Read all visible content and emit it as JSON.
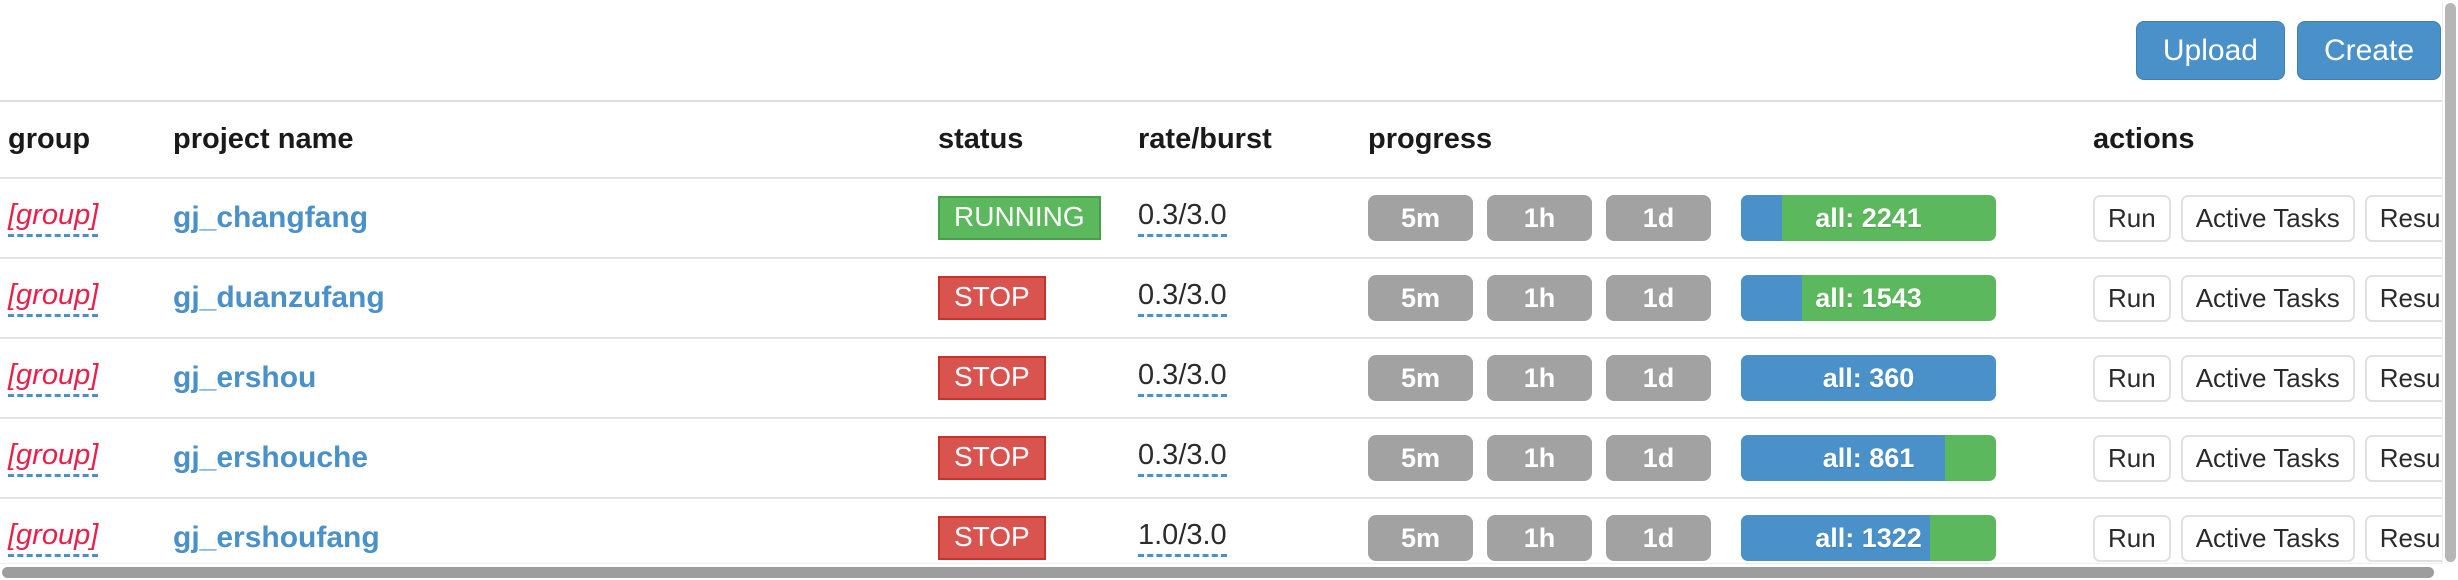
{
  "toolbar": {
    "upload_label": "Upload",
    "create_label": "Create"
  },
  "table": {
    "headers": {
      "group": "group",
      "project_name": "project name",
      "status": "status",
      "rate_burst": "rate/burst",
      "progress": "progress",
      "actions": "actions"
    },
    "time_buttons": {
      "m5": "5m",
      "h1": "1h",
      "d1": "1d"
    },
    "action_buttons": {
      "run": "Run",
      "active_tasks": "Active Tasks",
      "results": "Results"
    },
    "rows": [
      {
        "group": "[group]",
        "name": "gj_changfang",
        "status": "RUNNING",
        "status_kind": "running",
        "rate": "0.3/3.0",
        "progress_label": "all: 2241",
        "progress_all": 2241,
        "blue_pct": 16,
        "green_pct": 84
      },
      {
        "group": "[group]",
        "name": "gj_duanzufang",
        "status": "STOP",
        "status_kind": "stop",
        "rate": "0.3/3.0",
        "progress_label": "all: 1543",
        "progress_all": 1543,
        "blue_pct": 24,
        "green_pct": 76
      },
      {
        "group": "[group]",
        "name": "gj_ershou",
        "status": "STOP",
        "status_kind": "stop",
        "rate": "0.3/3.0",
        "progress_label": "all: 360",
        "progress_all": 360,
        "blue_pct": 100,
        "green_pct": 0
      },
      {
        "group": "[group]",
        "name": "gj_ershouche",
        "status": "STOP",
        "status_kind": "stop",
        "rate": "0.3/3.0",
        "progress_label": "all: 861",
        "progress_all": 861,
        "blue_pct": 80,
        "green_pct": 20
      },
      {
        "group": "[group]",
        "name": "gj_ershoufang",
        "status": "STOP",
        "status_kind": "stop",
        "rate": "1.0/3.0",
        "progress_label": "all: 1322",
        "progress_all": 1322,
        "blue_pct": 74,
        "green_pct": 26
      }
    ]
  },
  "colors": {
    "primary": "#4a90c9",
    "success": "#5cb85c",
    "danger": "#d9534f",
    "group_link": "#e8204a",
    "muted_button": "#a2a2a2"
  }
}
